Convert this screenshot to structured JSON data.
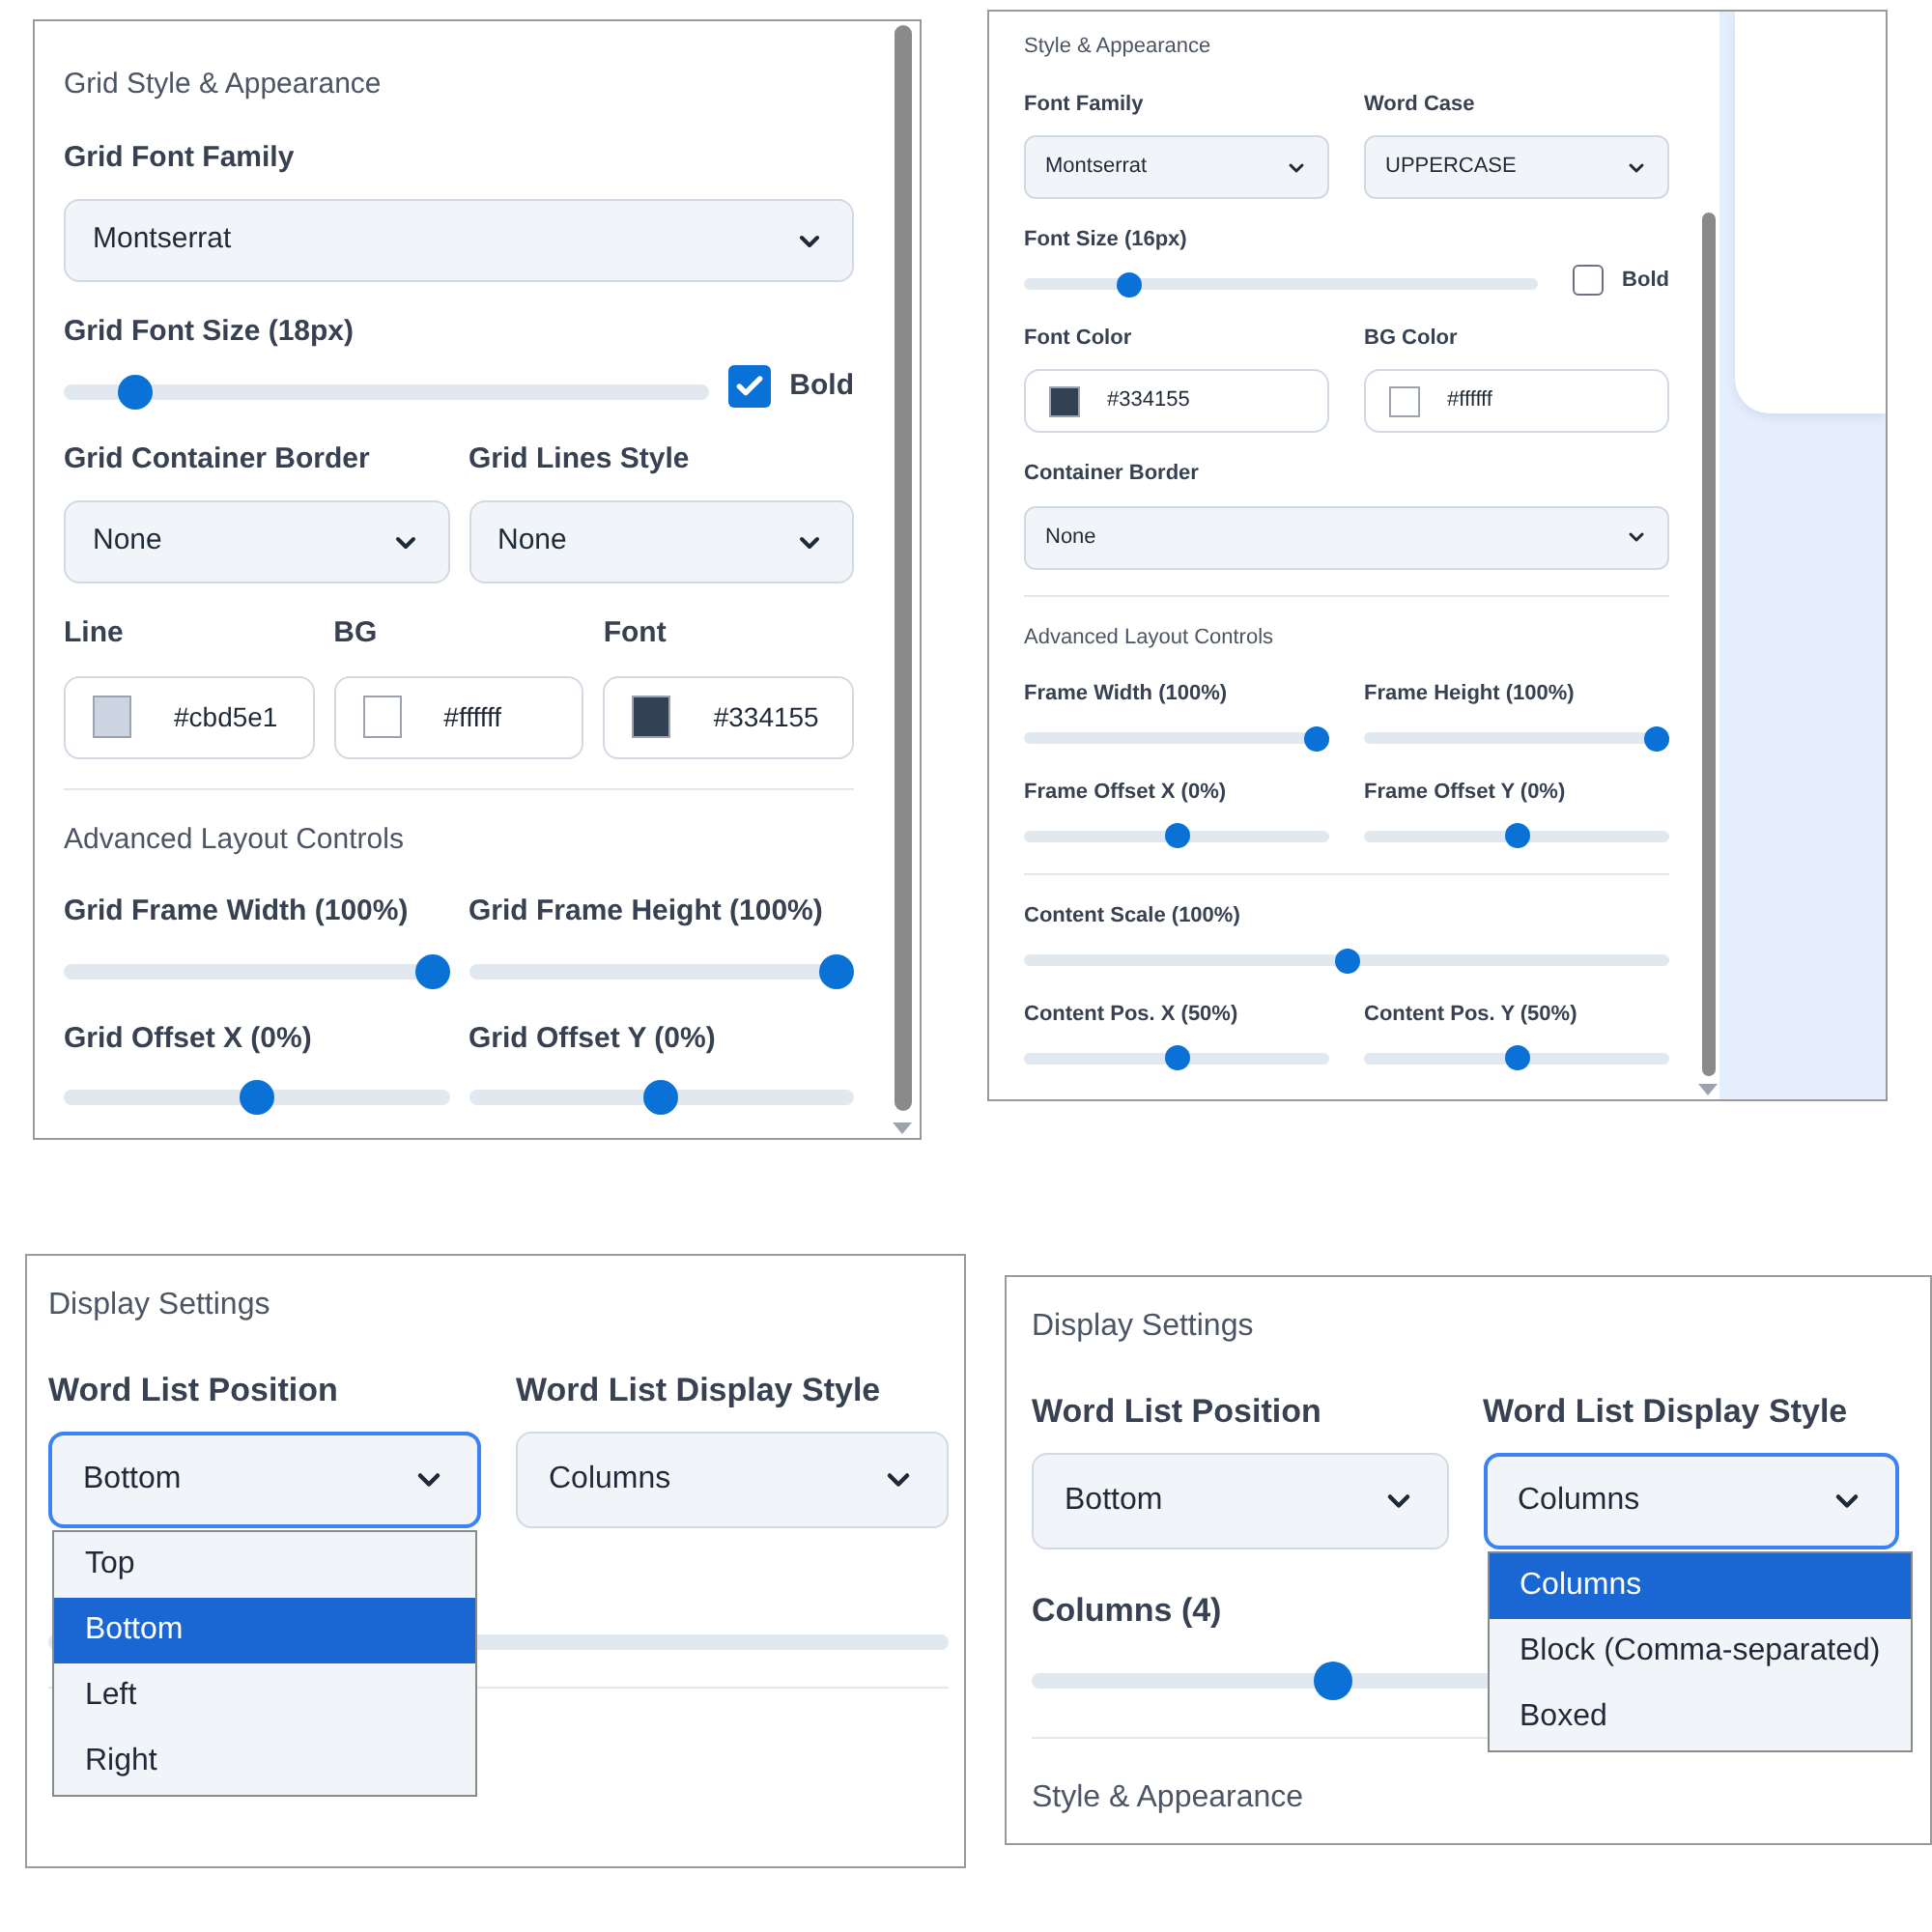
{
  "panels": [
    {
      "rows": [
        {
          "items": [
            {
              "kind": "heading",
              "text": "Grid Style & Appearance"
            }
          ]
        },
        {
          "items": [
            {
              "kind": "select",
              "label": "Grid Font Family",
              "value": "Montserrat",
              "focused": false
            }
          ]
        },
        {
          "items": [
            {
              "kind": "slider",
              "label": "Grid Font Size (18px)",
              "level": 0.09
            },
            {
              "kind": "checkbox",
              "label": "Bold",
              "checked": true
            }
          ]
        },
        {
          "items": [
            {
              "kind": "select",
              "label": "Grid Container Border",
              "value": "None",
              "focused": false
            },
            {
              "kind": "select",
              "label": "Grid Lines Style",
              "value": "None",
              "focused": false
            }
          ]
        },
        {
          "items": [
            {
              "kind": "color",
              "label": "Line",
              "value": "#cbd5e1",
              "color": "#cbd5e1"
            },
            {
              "kind": "color",
              "label": "BG",
              "value": "#ffffff",
              "color": "#ffffff"
            },
            {
              "kind": "color",
              "label": "Font",
              "value": "#334155",
              "color": "#334155"
            }
          ]
        },
        {
          "items": [
            {
              "kind": "divider"
            }
          ]
        },
        {
          "items": [
            {
              "kind": "heading",
              "text": "Advanced Layout Controls"
            }
          ]
        },
        {
          "items": [
            {
              "kind": "slider",
              "label": "Grid Frame Width (100%)",
              "level": 1
            },
            {
              "kind": "slider",
              "label": "Grid Frame Height (100%)",
              "level": 1
            }
          ]
        },
        {
          "items": [
            {
              "kind": "slider",
              "label": "Grid Offset X (0%)",
              "level": 0.5
            },
            {
              "kind": "slider",
              "label": "Grid Offset Y (0%)",
              "level": 0.5
            }
          ]
        }
      ]
    },
    {
      "rows": [
        {
          "items": [
            {
              "kind": "heading",
              "text": "Style & Appearance"
            }
          ]
        },
        {
          "items": [
            {
              "kind": "select",
              "label": "Font Family",
              "value": "Montserrat",
              "focused": false
            },
            {
              "kind": "select",
              "label": "Word Case",
              "value": "UPPERCASE",
              "focused": false
            }
          ]
        },
        {
          "items": [
            {
              "kind": "slider",
              "label": "Font Size (16px)",
              "level": 0.19
            },
            {
              "kind": "checkbox",
              "label": "Bold",
              "checked": false
            }
          ]
        },
        {
          "items": [
            {
              "kind": "color",
              "label": "Font Color",
              "value": "#334155",
              "color": "#334155"
            },
            {
              "kind": "color",
              "label": "BG Color",
              "value": "#ffffff",
              "color": "#ffffff"
            }
          ]
        },
        {
          "items": [
            {
              "kind": "select",
              "label": "Container Border",
              "value": "None",
              "focused": false
            }
          ]
        },
        {
          "items": [
            {
              "kind": "divider"
            }
          ]
        },
        {
          "items": [
            {
              "kind": "heading",
              "text": "Advanced Layout Controls"
            }
          ]
        },
        {
          "items": [
            {
              "kind": "slider",
              "label": "Frame Width (100%)",
              "level": 1
            },
            {
              "kind": "slider",
              "label": "Frame Height (100%)",
              "level": 1
            }
          ]
        },
        {
          "items": [
            {
              "kind": "slider",
              "label": "Frame Offset X (0%)",
              "level": 0.5
            },
            {
              "kind": "slider",
              "label": "Frame Offset Y (0%)",
              "level": 0.5
            }
          ]
        },
        {
          "items": [
            {
              "kind": "divider"
            }
          ]
        },
        {
          "items": [
            {
              "kind": "slider",
              "label": "Content Scale (100%)",
              "level": 0.5
            }
          ]
        },
        {
          "items": [
            {
              "kind": "slider",
              "label": "Content Pos. X (50%)",
              "level": 0.5
            },
            {
              "kind": "slider",
              "label": "Content Pos. Y (50%)",
              "level": 0.5
            }
          ]
        }
      ]
    },
    {
      "rows": [
        {
          "items": [
            {
              "kind": "heading",
              "text": "Display Settings"
            }
          ]
        },
        {
          "items": [
            {
              "kind": "select",
              "label": "Word List Position",
              "value": "Bottom",
              "focused": true,
              "options": [
                {
                  "label": "Top",
                  "selected": false
                },
                {
                  "label": "Bottom",
                  "selected": true
                },
                {
                  "label": "Left",
                  "selected": false
                },
                {
                  "label": "Right",
                  "selected": false
                }
              ]
            },
            {
              "kind": "select",
              "label": "Word List Display Style",
              "value": "Columns",
              "focused": false
            }
          ]
        },
        {
          "items": [
            {
              "kind": "track"
            }
          ]
        },
        {
          "items": [
            {
              "kind": "divider"
            }
          ]
        }
      ]
    },
    {
      "rows": [
        {
          "items": [
            {
              "kind": "heading",
              "text": "Display Settings"
            }
          ]
        },
        {
          "items": [
            {
              "kind": "select",
              "label": "Word List Position",
              "value": "Bottom",
              "focused": false
            },
            {
              "kind": "select",
              "label": "Word List Display Style",
              "value": "Columns",
              "focused": true,
              "options": [
                {
                  "label": "Columns",
                  "selected": true
                },
                {
                  "label": "Block (Comma-separated)",
                  "selected": false
                },
                {
                  "label": "Boxed",
                  "selected": false
                }
              ]
            }
          ]
        },
        {
          "items": [
            {
              "kind": "slider",
              "label": "Columns (4)",
              "level": 0.34
            }
          ]
        },
        {
          "items": [
            {
              "kind": "divider"
            }
          ]
        },
        {
          "items": [
            {
              "kind": "heading",
              "text": "Style & Appearance"
            }
          ]
        }
      ]
    }
  ]
}
